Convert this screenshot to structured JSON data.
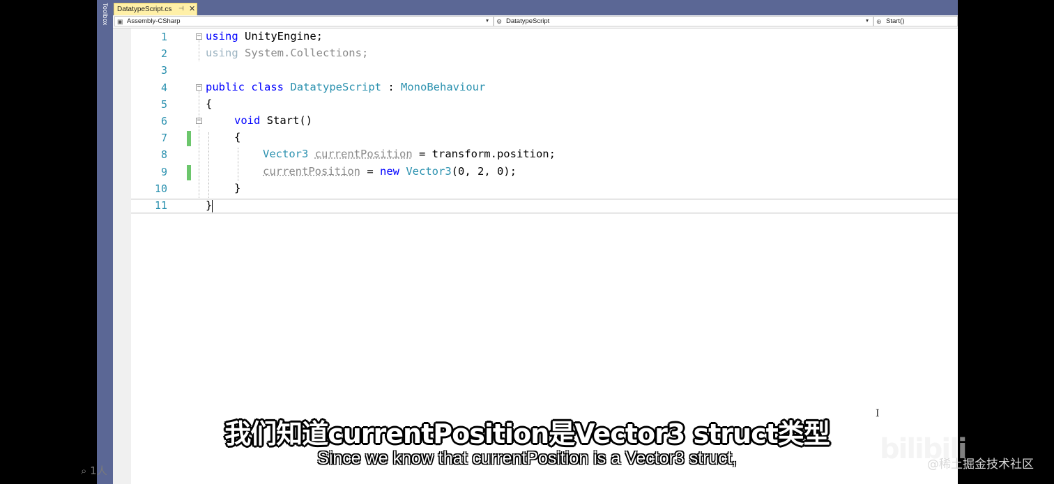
{
  "toolbox": {
    "label": "Toolbox"
  },
  "tab": {
    "title": "DatatypeScript.cs",
    "pin": "⊣",
    "close": "✕"
  },
  "navbar": {
    "project": "Assembly-CSharp",
    "type": "DatatypeScript",
    "member": "Start()"
  },
  "line_numbers": [
    "1",
    "2",
    "3",
    "4",
    "5",
    "6",
    "7",
    "8",
    "9",
    "10",
    "11"
  ],
  "code": {
    "l1_kw": "using",
    "l1_rest": " UnityEngine;",
    "l2_kw": "using",
    "l2_rest": " System.Collections;",
    "l4_kw1": "public",
    "l4_kw2": "class",
    "l4_type": "DatatypeScript",
    "l4_colon": " : ",
    "l4_base": "MonoBehaviour",
    "l5": "{",
    "l6_kw": "void",
    "l6_rest": " Start()",
    "l7": "{",
    "l8_type": "Vector3",
    "l8_var": "currentPosition",
    "l8_rest": " = transform.position;",
    "l9_var": "currentPosition",
    "l9_eq": " = ",
    "l9_kw": "new",
    "l9_type": "Vector3",
    "l9_rest": "(0, 2, 0);",
    "l10": "}",
    "l11": "}"
  },
  "subtitles": {
    "chinese": "我们知道currentPosition是Vector3 struct类型",
    "english": "Since we know that currentPosition is a Vector3 struct,"
  },
  "watermarks": {
    "bilibili": "bilibili",
    "juejin": "@稀土掘金技术社区",
    "viewers": "⌕ 1人"
  }
}
